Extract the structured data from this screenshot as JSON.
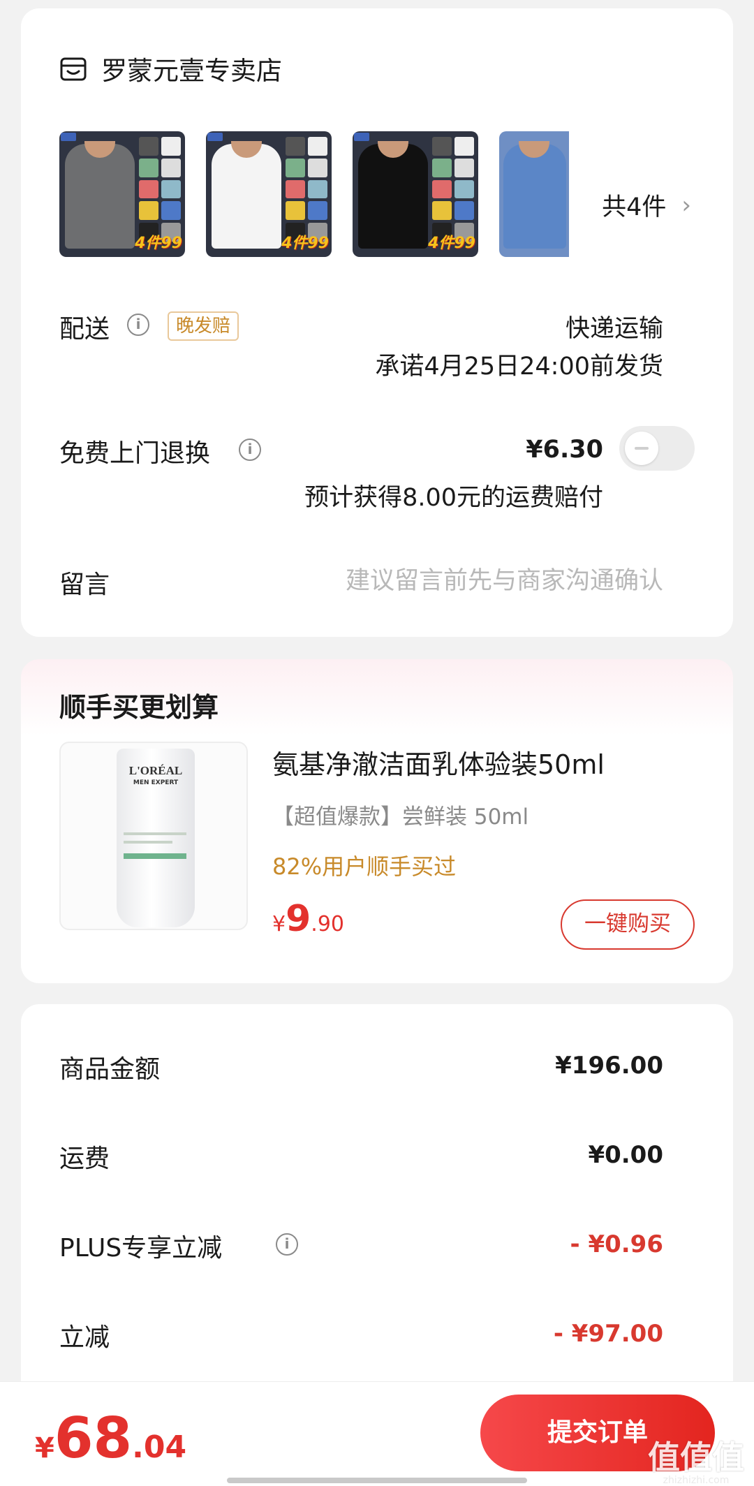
{
  "store": {
    "name": "罗蒙元壹专卖店",
    "thumbnail_badge": "4件99",
    "item_count": "共4件",
    "more_chevron": "›"
  },
  "delivery": {
    "label": "配送",
    "badge": "晚发赔",
    "method": "快递运输",
    "promise": "承诺4月25日24:00前发货"
  },
  "return_service": {
    "label": "免费上门退换",
    "price": "¥6.30",
    "note": "预计获得8.00元的运费赔付",
    "toggle_on": false
  },
  "message": {
    "label": "留言",
    "placeholder": "建议留言前先与商家沟通确认"
  },
  "addon": {
    "section_title": "顺手买更划算",
    "product_name": "氨基净澈洁面乳体验装50ml",
    "description": "【超值爆款】尝鲜装 50ml",
    "purchase_rate": "82%用户顺手买过",
    "price_symbol": "¥",
    "price_int": "9",
    "price_dec": ".90",
    "buy_label": "一键购买",
    "image_brand": "L'ORÉAL",
    "image_sub": "MEN EXPERT"
  },
  "summary": {
    "rows": [
      {
        "label": "商品金额",
        "value": "¥196.00"
      },
      {
        "label": "运费",
        "value": "¥0.00"
      },
      {
        "label": "PLUS专享立减",
        "value": "- ¥0.96"
      },
      {
        "label": "立减",
        "value": "- ¥97.00"
      }
    ]
  },
  "footer": {
    "total_symbol": "¥",
    "total_int": "68",
    "total_dec": ".04",
    "submit_label": "提交订单"
  },
  "watermark": {
    "main": "值值值",
    "sub": "zhizhizhi.com"
  },
  "colors": {
    "accent_red": "#e3312d",
    "gold": "#c88a2a",
    "page_bg": "#f2f2f2"
  },
  "icons": [
    "store-icon",
    "info-icon",
    "chevron-right-icon",
    "toggle-icon"
  ]
}
